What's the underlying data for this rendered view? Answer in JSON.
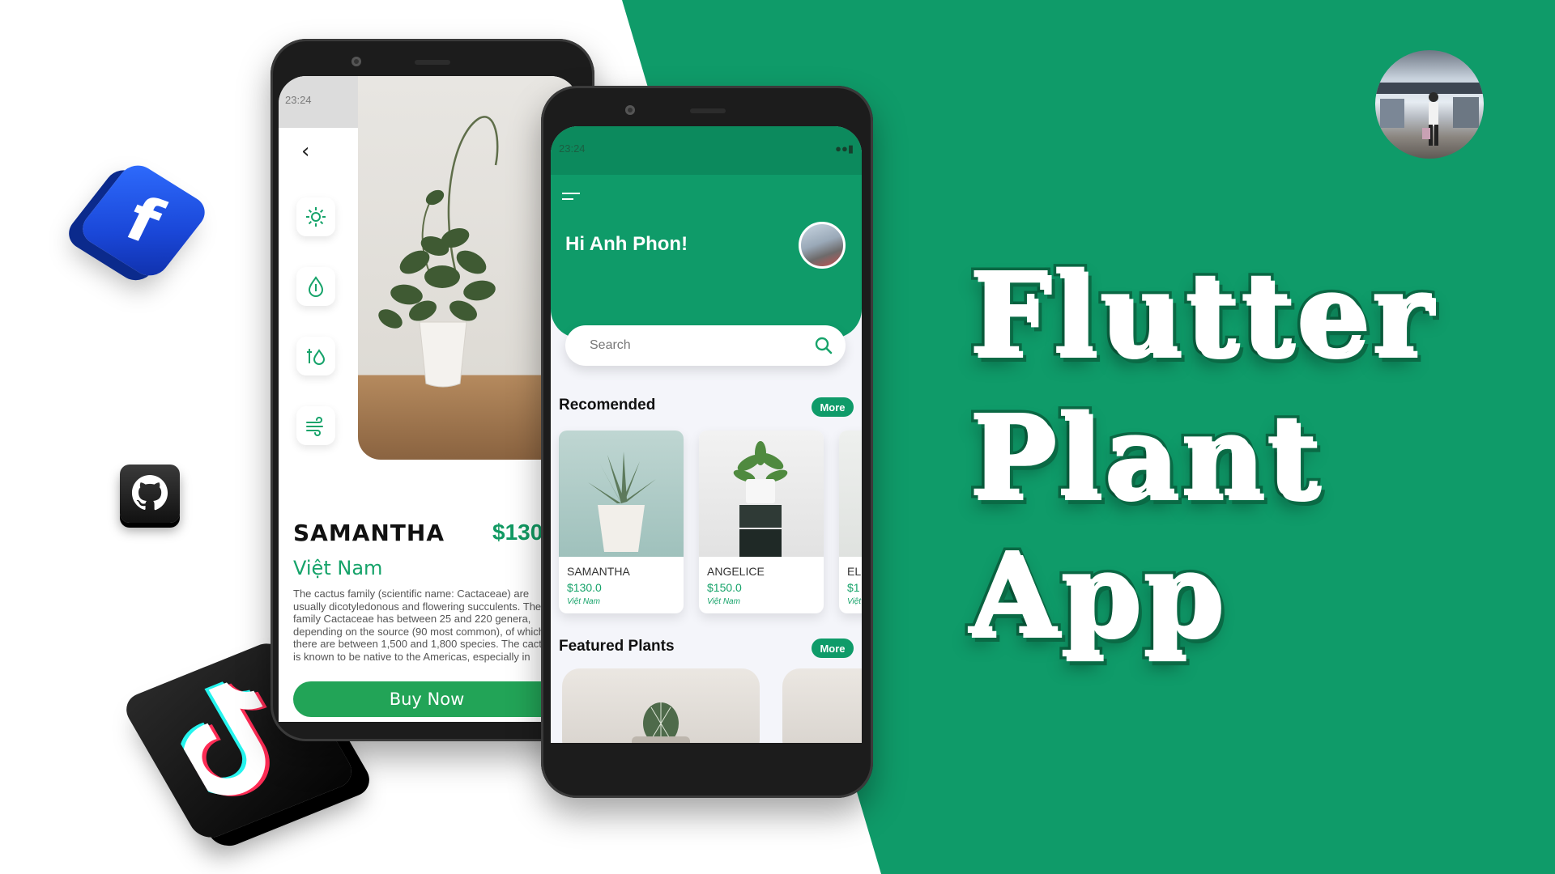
{
  "colors": {
    "brand_green": "#0f9b69",
    "button_green": "#22a457",
    "price_green": "#129a63",
    "white": "#ffffff"
  },
  "icons": [
    "facebook-icon",
    "github-icon",
    "tiktok-icon",
    "back-arrow-icon",
    "sun-icon",
    "temperature-drop-icon",
    "humidity-icon",
    "wind-icon",
    "menu-icon",
    "search-icon"
  ],
  "detail_screen": {
    "status_time": "23:24",
    "name": "SAMANTHA",
    "price": "$130",
    "origin": "Việt Nam",
    "description": "The cactus family (scientific name: Cactaceae) are usually dicotyledonous and flowering succulents. The family Cactaceae has between 25 and 220 genera, depending on the source (90 most common), of which there are between 1,500 and 1,800 species. The cactus is known to be native to the Americas, especially in",
    "buy_label": "Buy Now"
  },
  "home_screen": {
    "status_time": "23:24",
    "greeting": "Hi Anh Phon!",
    "search_placeholder": "Search",
    "recommended_title": "Recomended",
    "more_label": "More",
    "recommended": [
      {
        "name": "SAMANTHA",
        "price": "$130.0",
        "origin": "Việt Nam"
      },
      {
        "name": "ANGELICE",
        "price": "$150.0",
        "origin": "Việt Nam"
      },
      {
        "name": "EL",
        "price": "$1",
        "origin": "Việt"
      }
    ],
    "featured_title": "Featured Plants",
    "featured_more_label": "More"
  },
  "title": {
    "line1": "Flutter",
    "line2": "Plant",
    "line3": "App"
  }
}
